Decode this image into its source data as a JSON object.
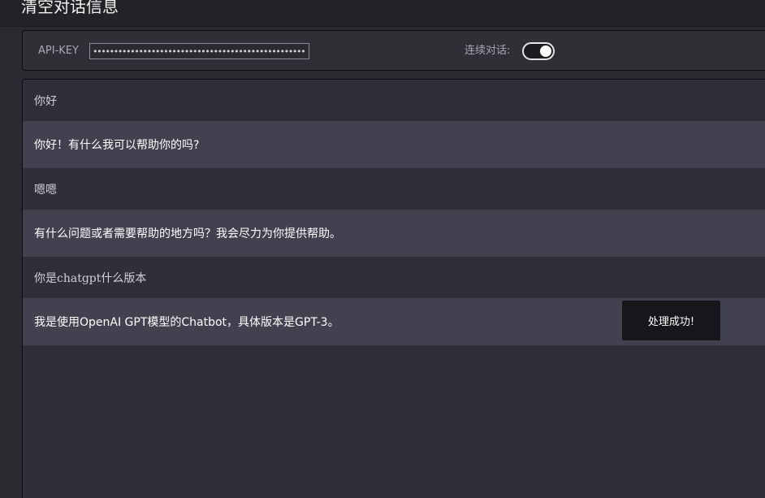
{
  "header": {
    "title": "清空对话信息"
  },
  "config": {
    "api_key_label": "API-KEY",
    "api_key_value": "••••••••••••••••••••••••••••••••••••••••••••••••••••••",
    "continuous_label": "连续对话:",
    "continuous_enabled": true
  },
  "messages": [
    {
      "role": "user",
      "text": "你好"
    },
    {
      "role": "bot",
      "text": "你好！有什么我可以帮助你的吗?"
    },
    {
      "role": "user",
      "text": "嗯嗯"
    },
    {
      "role": "bot",
      "text": "有什么问题或者需要帮助的地方吗？我会尽力为你提供帮助。"
    },
    {
      "role": "user",
      "text": "你是chatgpt什么版本"
    },
    {
      "role": "bot",
      "text": "我是使用OpenAI GPT模型的Chatbot，具体版本是GPT-3。"
    }
  ],
  "toast": {
    "text": "处理成功!"
  },
  "colors": {
    "background": "#2a2a31",
    "bot_row": "#41414f",
    "user_row": "#2f2f39",
    "toast_bg": "#16161b"
  }
}
